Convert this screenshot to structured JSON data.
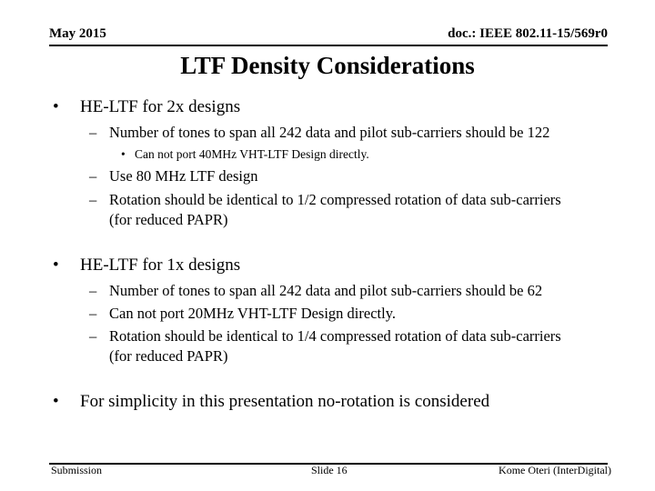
{
  "header": {
    "date": "May 2015",
    "doc_id": "doc.: IEEE 802.11-15/569r0"
  },
  "title": "LTF Density Considerations",
  "bullets": [
    {
      "text": "HE-LTF for 2x designs",
      "sub": [
        {
          "text": "Number of tones to span all 242 data and pilot sub-carriers should be 122",
          "sub": [
            {
              "text": "Can not port 40MHz VHT-LTF Design directly."
            }
          ]
        },
        {
          "text": "Use 80 MHz LTF design"
        },
        {
          "text": "Rotation should be identical to 1/2 compressed rotation of data sub-carriers",
          "text2": "(for reduced PAPR)"
        }
      ]
    },
    {
      "text": "HE-LTF for 1x designs",
      "sub": [
        {
          "text": "Number of tones to span all 242 data and pilot sub-carriers should be 62"
        },
        {
          "text": "Can not port 20MHz VHT-LTF Design directly."
        },
        {
          "text": "Rotation should be identical to 1/4 compressed rotation of data sub-carriers",
          "text2": "(for reduced PAPR)"
        }
      ]
    },
    {
      "text": "For simplicity in this presentation no-rotation is considered"
    }
  ],
  "bullet_glyphs": {
    "level1": "•",
    "level2": "–",
    "level3": "•"
  },
  "footer": {
    "left": "Submission",
    "center": "Slide 16",
    "right": "Kome Oteri (InterDigital)"
  }
}
